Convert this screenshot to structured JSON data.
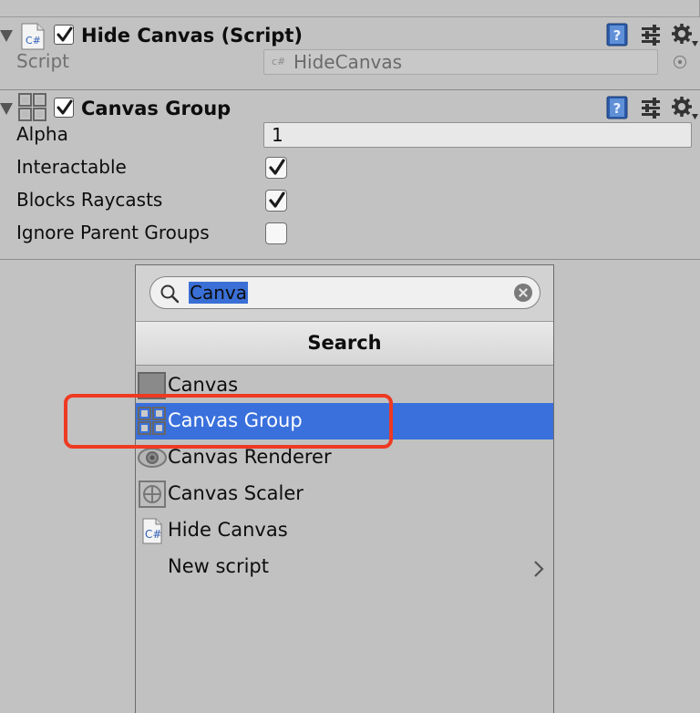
{
  "hide_canvas_component": {
    "icon_text": "C#",
    "title": "Hide Canvas (Script)",
    "script_label": "Script",
    "script_value_icon": "c#",
    "script_value": "HideCanvas"
  },
  "canvas_group_component": {
    "title": "Canvas Group",
    "alpha_label": "Alpha",
    "alpha_value": "1",
    "interactable_label": "Interactable",
    "interactable_checked": true,
    "blocks_raycasts_label": "Blocks Raycasts",
    "blocks_raycasts_checked": true,
    "ignore_parent_groups_label": "Ignore Parent Groups",
    "ignore_parent_groups_checked": false
  },
  "header_icons": [
    "help-book-icon",
    "presets-sliders-icon",
    "gear-menu-icon"
  ],
  "add_component_popup": {
    "search_query": "Canva",
    "title": "Search",
    "items": [
      {
        "label": "Canvas",
        "icon": "canvas-icon",
        "selected": false
      },
      {
        "label": "Canvas Group",
        "icon": "canvas-group-icon",
        "selected": true
      },
      {
        "label": "Canvas Renderer",
        "icon": "canvas-renderer-icon",
        "selected": false
      },
      {
        "label": "Canvas Scaler",
        "icon": "canvas-scaler-icon",
        "selected": false
      },
      {
        "label": "Hide Canvas",
        "icon": "csharp-script-icon",
        "icon_text": "C#",
        "selected": false
      },
      {
        "label": "New script",
        "icon": "chevron-right-icon",
        "selected": false
      }
    ]
  },
  "colors": {
    "selection": "#3a70dc",
    "annotation_red": "#ee3a22",
    "panel_bg": "#c2c2c2"
  }
}
